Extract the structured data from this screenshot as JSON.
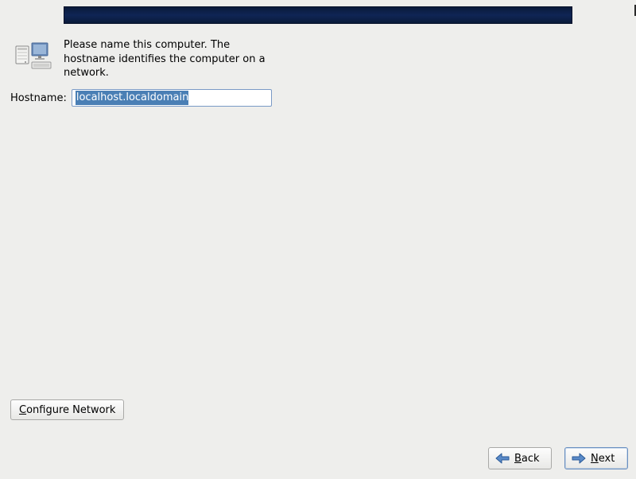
{
  "description": "Please name this computer.  The hostname identifies the computer on a network.",
  "hostname": {
    "label": "Hostname:",
    "value": "localhost.localdomain"
  },
  "buttons": {
    "configure_network": "Configure Network",
    "back": "Back",
    "next": "Next"
  }
}
